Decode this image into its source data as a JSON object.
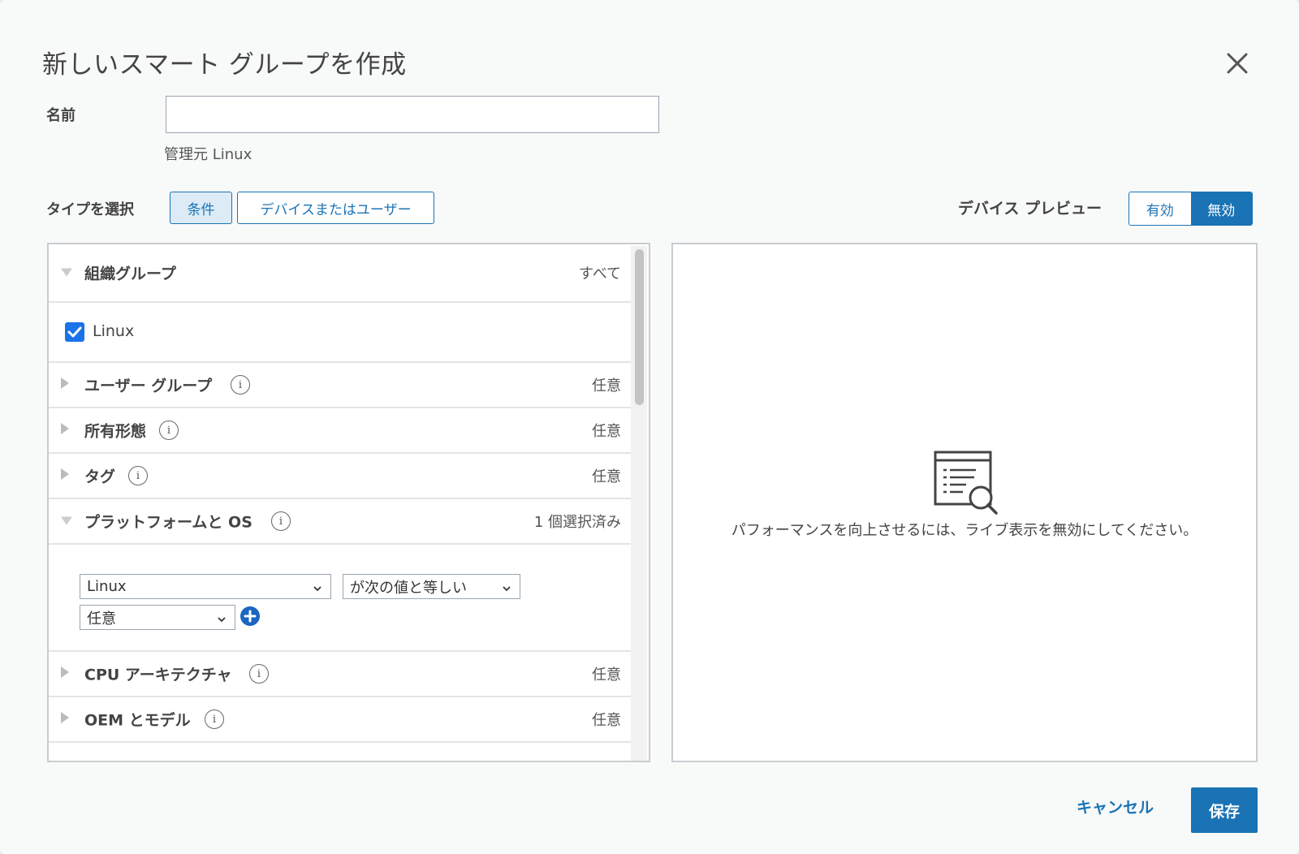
{
  "dialog": {
    "title": "新しいスマート グループを作成",
    "close_icon": "close-icon"
  },
  "name_field": {
    "label": "名前",
    "value": "",
    "placeholder": "",
    "managed_by": "管理元 Linux"
  },
  "type_select": {
    "label": "タイプを選択",
    "options": [
      "条件",
      "デバイスまたはユーザー"
    ],
    "selected": "条件"
  },
  "device_preview": {
    "label": "デバイス プレビュー",
    "options": [
      "有効",
      "無効"
    ],
    "selected": "無効",
    "message": "パフォーマンスを向上させるには、ライブ表示を無効にしてください。",
    "icon": "list-search-icon"
  },
  "criteria": {
    "org_group": {
      "label": "組織グループ",
      "value": "すべて",
      "expanded": true
    },
    "org_checkbox": {
      "label": "Linux",
      "checked": true
    },
    "rows": [
      {
        "label": "ユーザー グループ",
        "value": "任意"
      },
      {
        "label": "所有形態",
        "value": "任意"
      },
      {
        "label": "タグ",
        "value": "任意"
      }
    ],
    "platform": {
      "label": "プラットフォームと OS",
      "value": "1 個選択済み",
      "expanded": true,
      "platform_select": "Linux",
      "operator_select": "が次の値と等しい",
      "version_select": "任意"
    },
    "rows_after": [
      {
        "label": "CPU アーキテクチャ",
        "value": "任意"
      },
      {
        "label": "OEM とモデル",
        "value": "任意"
      }
    ],
    "info_icon": "i"
  },
  "footer": {
    "cancel": "キャンセル",
    "save": "保存"
  },
  "colors": {
    "accent": "#1a73b5",
    "checkbox": "#1a73e8",
    "background": "#f8f9f9"
  }
}
